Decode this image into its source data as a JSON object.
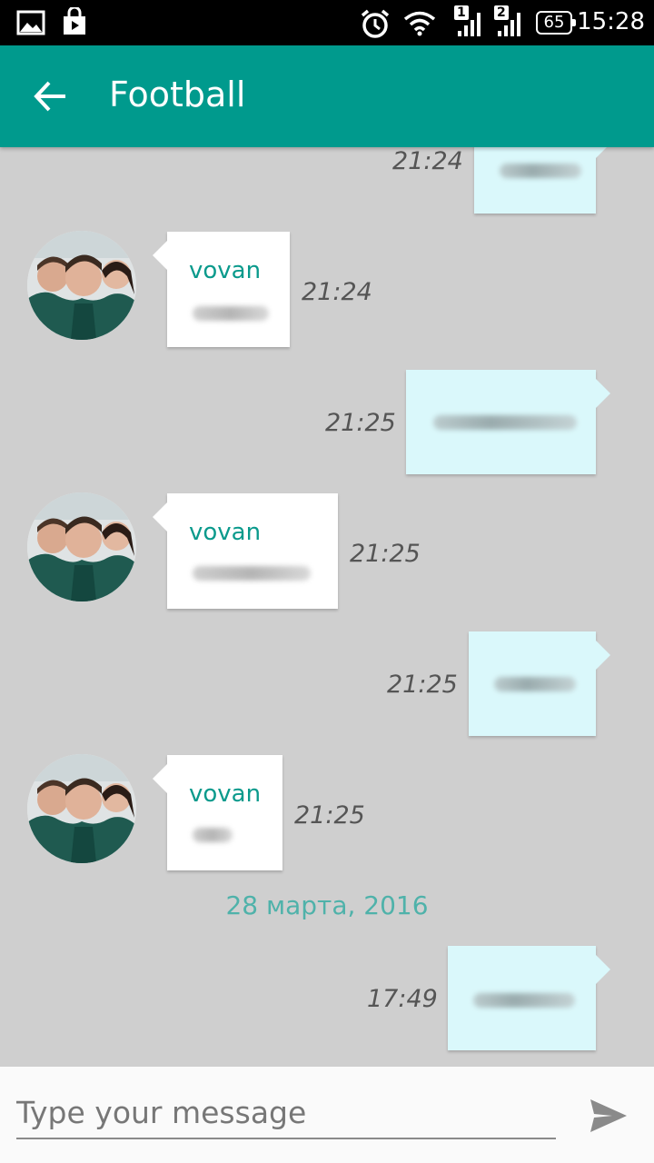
{
  "status_bar": {
    "time": "15:28",
    "battery": "65",
    "sim1": "1",
    "sim2": "2",
    "icons": [
      "image-icon",
      "store-icon",
      "alarm-icon",
      "wifi-icon",
      "signal-icon",
      "battery-icon"
    ]
  },
  "header": {
    "title": "Football",
    "back_icon": "arrow-left-icon",
    "color": "#009a8d"
  },
  "messages": [
    {
      "direction": "out",
      "time": "21:24"
    },
    {
      "direction": "in",
      "sender": "vovan",
      "time": "21:24"
    },
    {
      "direction": "out",
      "time": "21:25"
    },
    {
      "direction": "in",
      "sender": "vovan",
      "time": "21:25"
    },
    {
      "direction": "out",
      "time": "21:25"
    },
    {
      "direction": "in",
      "sender": "vovan",
      "time": "21:25"
    },
    {
      "date_separator": "28 марта, 2016"
    },
    {
      "direction": "out",
      "time": "17:49"
    }
  ],
  "composer": {
    "placeholder": "Type your message",
    "send_icon": "send-icon"
  }
}
